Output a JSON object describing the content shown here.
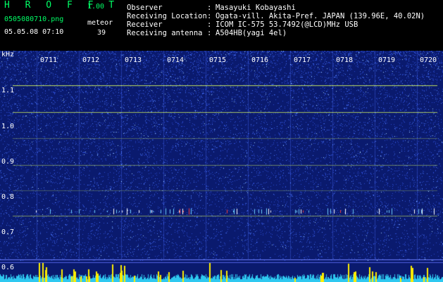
{
  "header": {
    "brand": "H R O F F T",
    "version": "1.00",
    "filename": "0505080710.png",
    "datetime": "05.05.08 07:10",
    "meteor_label": "meteor",
    "meteor_count": "39"
  },
  "info": [
    {
      "label": "Observer",
      "value": "Masayuki Kobayashi"
    },
    {
      "label": "Receiving Location",
      "value": "Ogata-vill. Akita-Pref. JAPAN (139.96E, 40.02N)"
    },
    {
      "label": "Receiver",
      "value": "ICOM IC-575 53.7492(@LCD)MHz USB"
    },
    {
      "label": "Receiving antenna",
      "value": "A504HB(yagi 4el)"
    }
  ],
  "spectrogram": {
    "y_unit": "kHz",
    "y_ticks": [
      "1.1",
      "1.0",
      "0.9",
      "0.8",
      "0.7",
      "0.6"
    ],
    "time_labels": [
      "0711",
      "0712",
      "0713",
      "0714",
      "0715",
      "0716",
      "0717",
      "0718",
      "0719",
      "0720"
    ],
    "colors": {
      "background": "#0a1a6e",
      "noise": "#2a4ad0",
      "line": "#c8e860",
      "bottom_band": "#2ec8f0",
      "meteor": "#ffee00"
    }
  }
}
